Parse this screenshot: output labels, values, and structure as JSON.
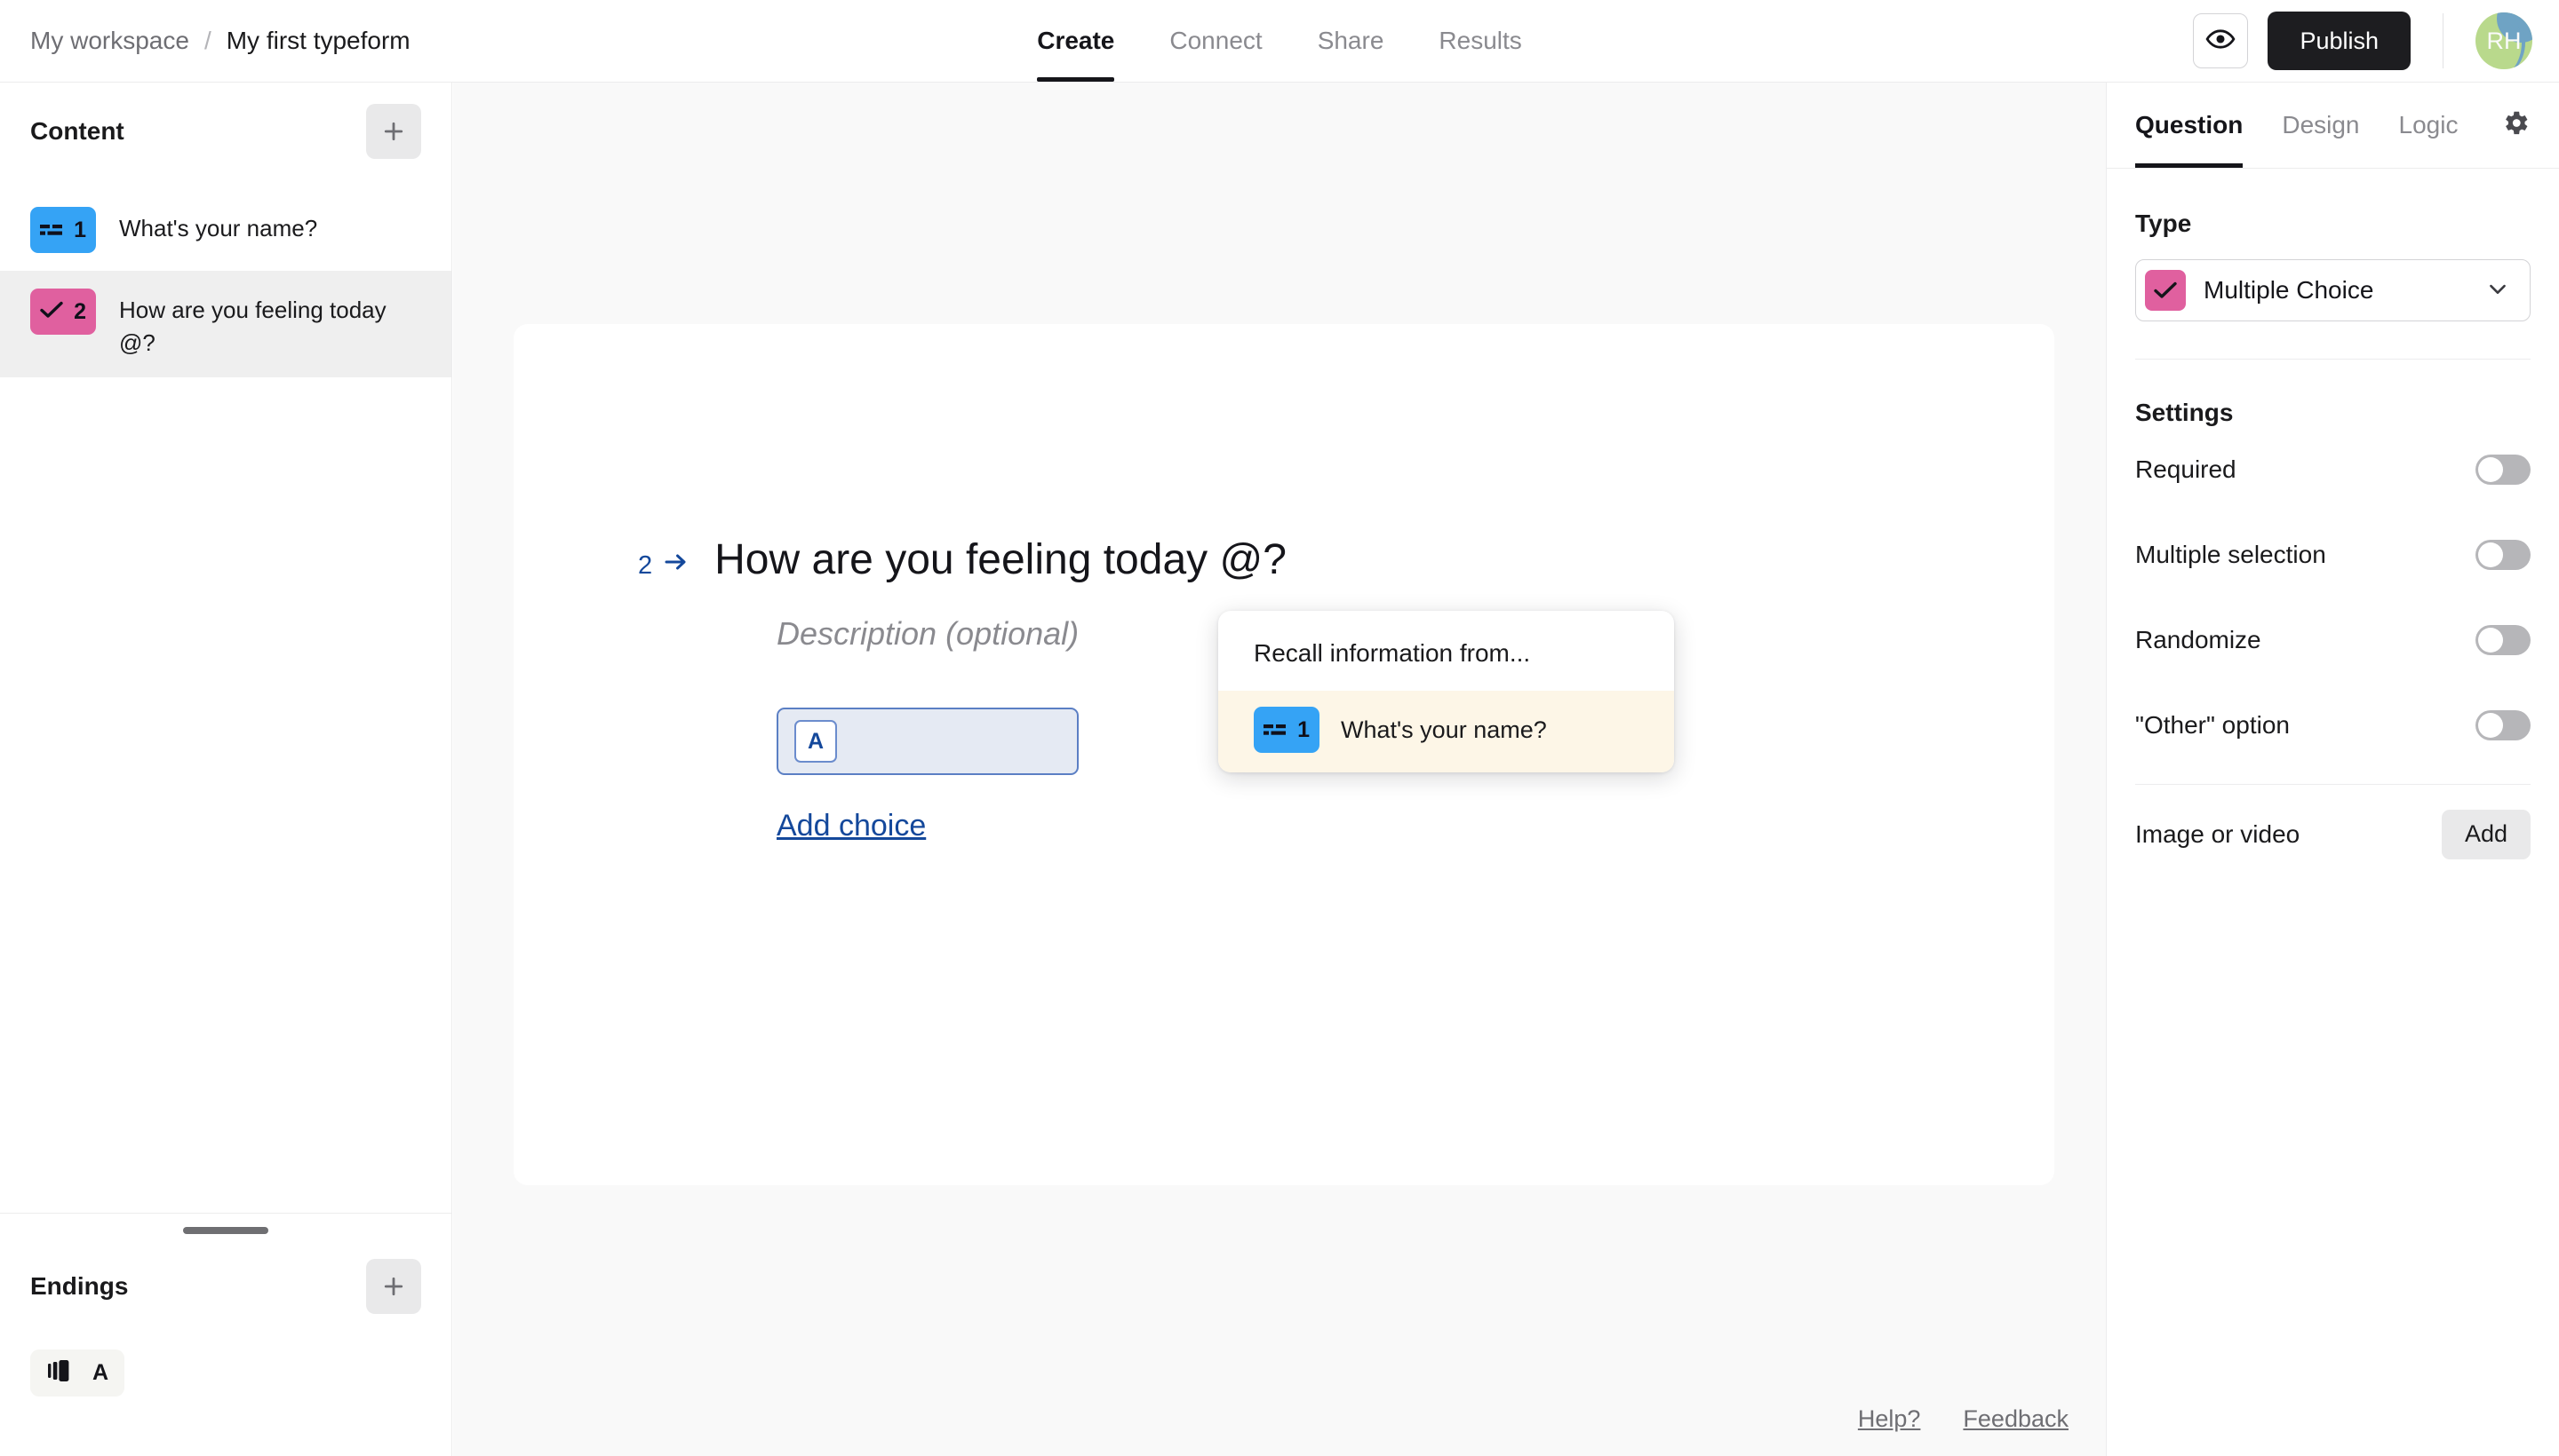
{
  "header": {
    "breadcrumb": {
      "workspace": "My workspace",
      "separator": "/",
      "form": "My first typeform"
    },
    "tabs": [
      {
        "label": "Create",
        "active": true
      },
      {
        "label": "Connect",
        "active": false
      },
      {
        "label": "Share",
        "active": false
      },
      {
        "label": "Results",
        "active": false
      }
    ],
    "preview_icon": "eye-icon",
    "publish_label": "Publish",
    "avatar_initials": "RH"
  },
  "sidebar": {
    "content": {
      "title": "Content",
      "add_icon": "plus-icon",
      "items": [
        {
          "number": "1",
          "icon": "short-text-icon",
          "badge_color": "#35a3f5",
          "label": "What's your name?",
          "selected": false
        },
        {
          "number": "2",
          "icon": "check-icon",
          "badge_color": "#e0609f",
          "label": "How are you feeling today @?",
          "selected": true
        }
      ]
    },
    "endings": {
      "title": "Endings",
      "add_icon": "plus-icon",
      "items": [
        {
          "icon": "ending-card-icon",
          "letter": "A"
        }
      ]
    }
  },
  "canvas": {
    "question": {
      "number": "2",
      "arrow_icon": "arrow-right-icon",
      "title": "How are you feeling today @?",
      "description_placeholder": "Description (optional)",
      "choices": [
        {
          "key": "A",
          "value": ""
        }
      ],
      "add_choice_label": "Add choice"
    },
    "recall_popup": {
      "title": "Recall information from...",
      "items": [
        {
          "number": "1",
          "icon": "short-text-icon",
          "badge_color": "#35a3f5",
          "label": "What's your name?",
          "highlighted": true
        }
      ]
    },
    "footer": {
      "help_label": "Help?",
      "feedback_label": "Feedback"
    }
  },
  "right_panel": {
    "tabs": [
      {
        "label": "Question",
        "active": true
      },
      {
        "label": "Design",
        "active": false
      },
      {
        "label": "Logic",
        "active": false
      }
    ],
    "settings_icon": "gear-icon",
    "type": {
      "label": "Type",
      "selected": "Multiple Choice",
      "icon": "check-icon",
      "icon_color": "#e0609f",
      "chevron_icon": "chevron-down-icon"
    },
    "settings": {
      "title": "Settings",
      "rows": [
        {
          "label": "Required",
          "on": false
        },
        {
          "label": "Multiple selection",
          "on": false
        },
        {
          "label": "Randomize",
          "on": false
        },
        {
          "label": "\"Other\" option",
          "on": false
        }
      ]
    },
    "media": {
      "label": "Image or video",
      "add_label": "Add"
    }
  },
  "colors": {
    "accent_blue": "#35a3f5",
    "accent_pink": "#e0609f",
    "link_blue": "#14489b",
    "dark": "#1d1d20",
    "canvas_bg": "#f9f9f9",
    "highlight_cream": "#fdf6e7"
  }
}
